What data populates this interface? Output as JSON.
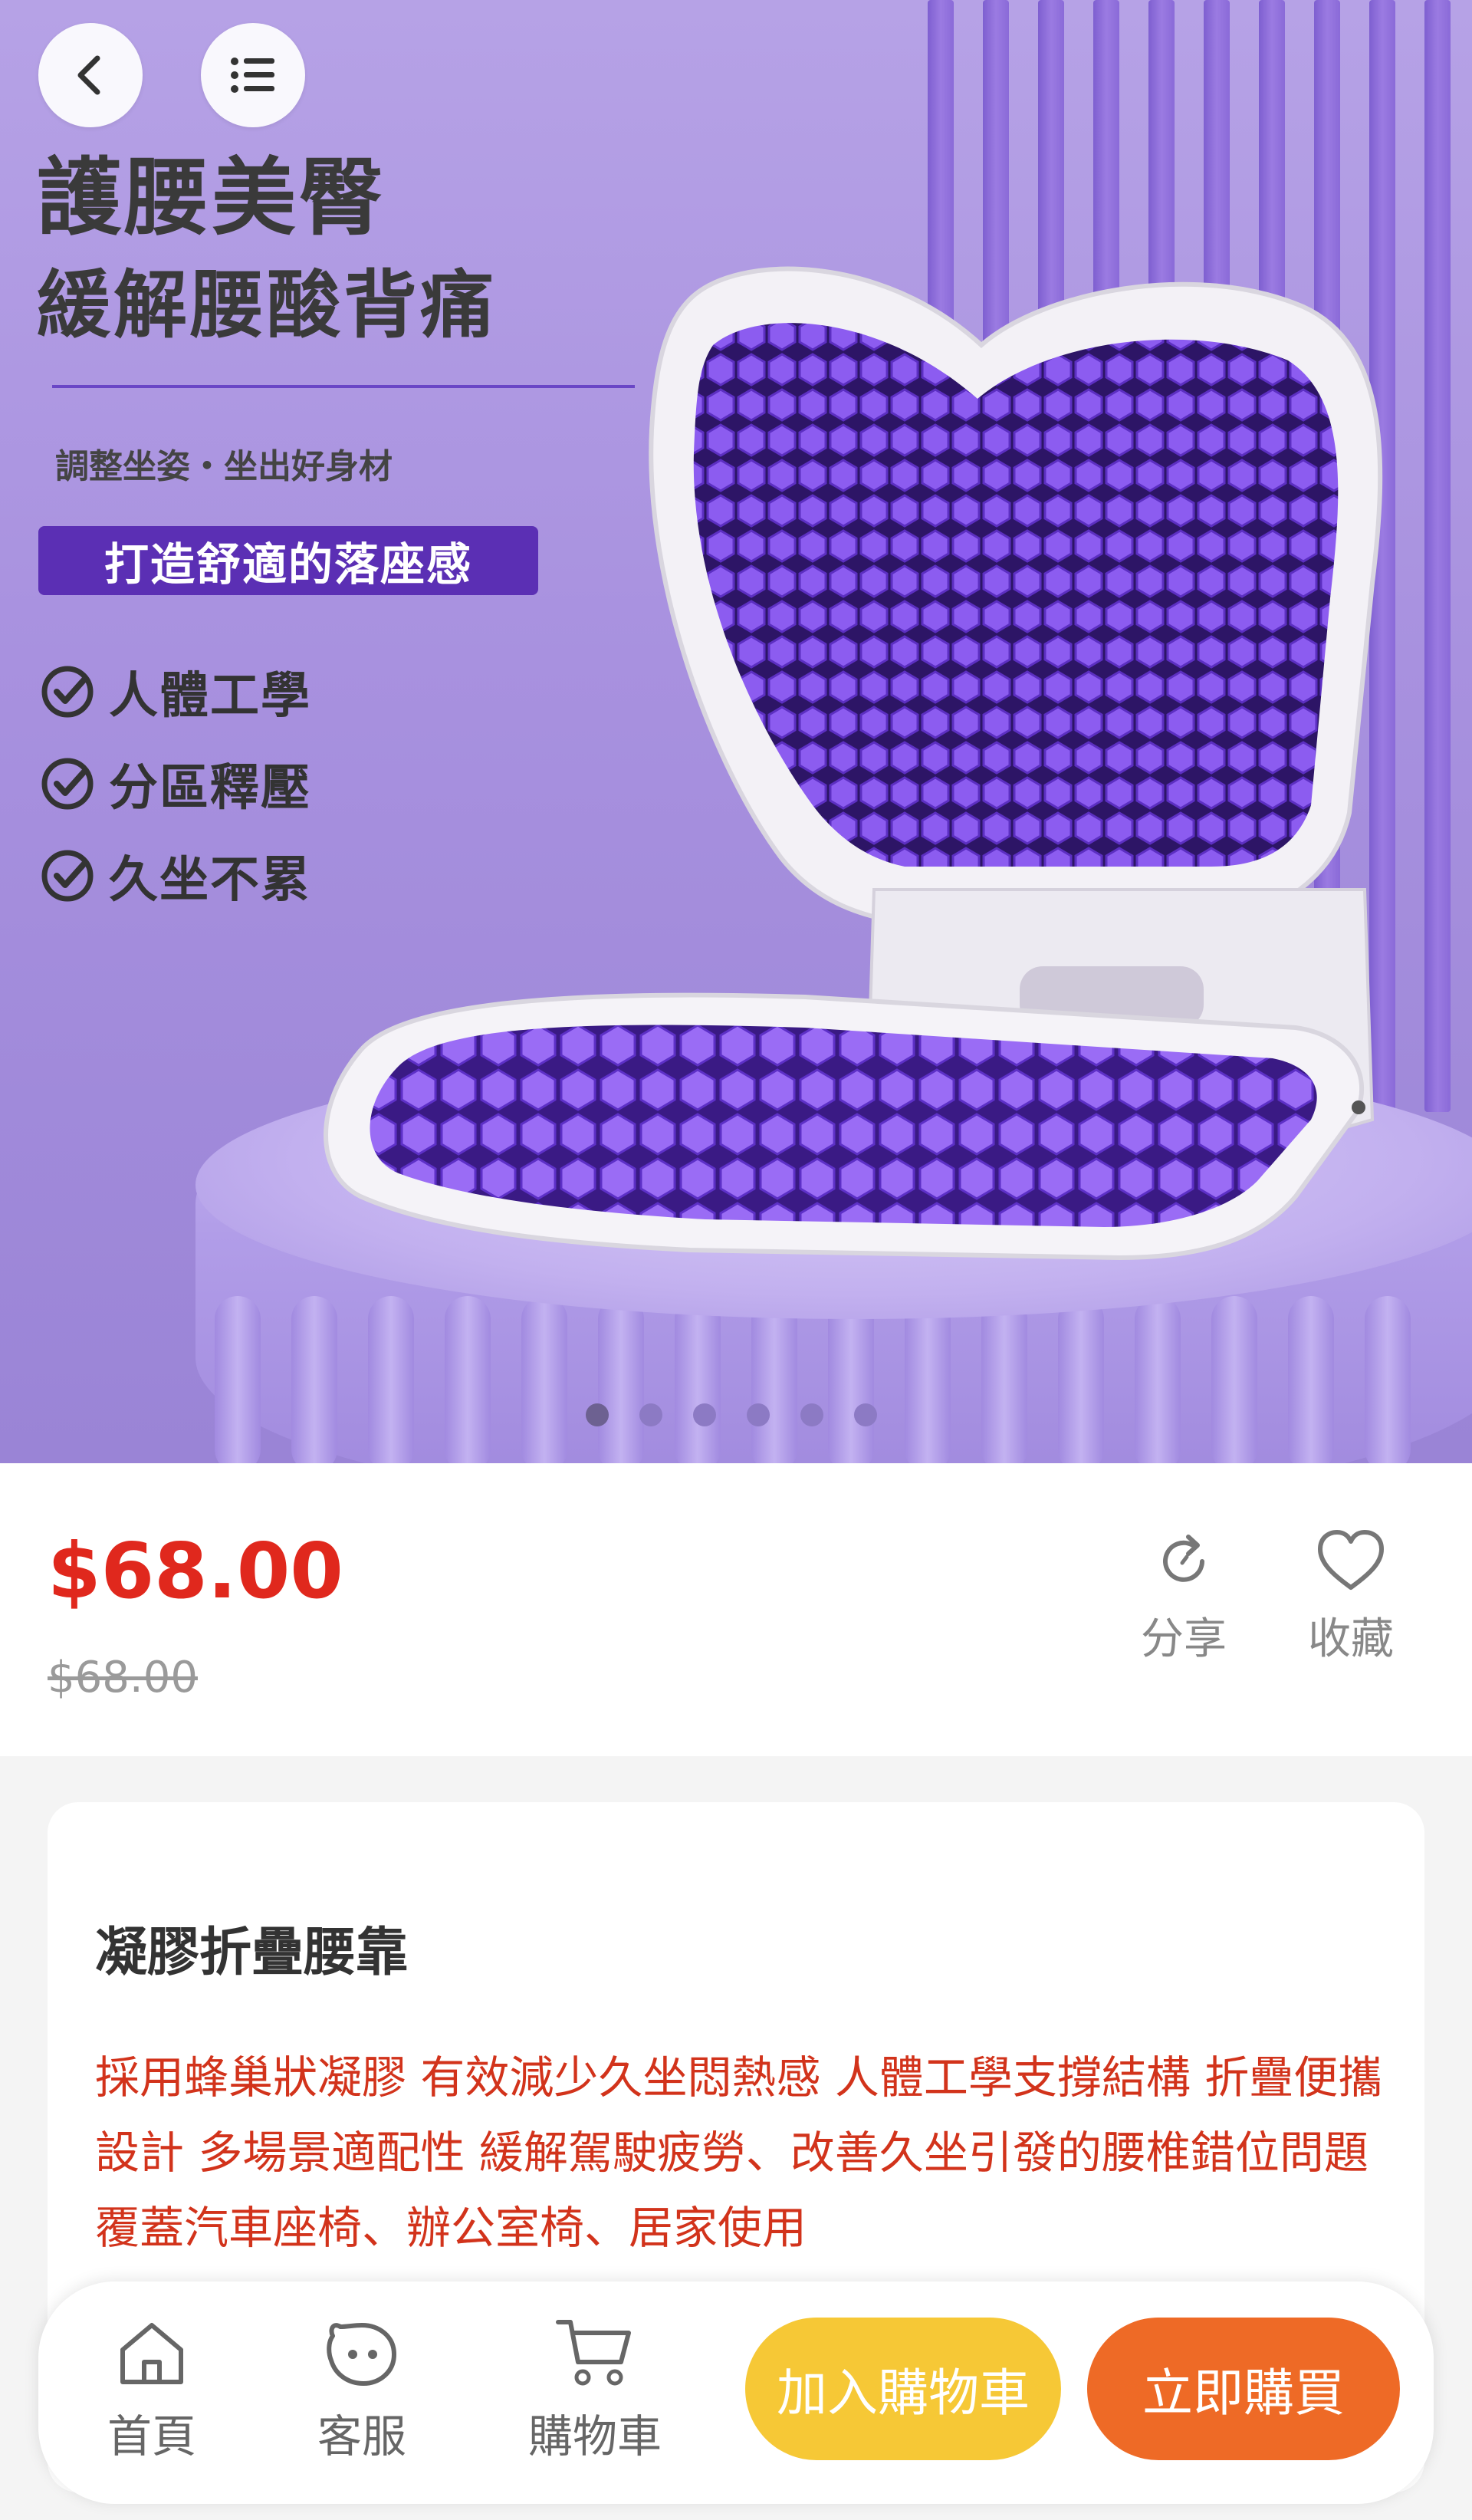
{
  "hero": {
    "title_line1": "護腰美臀",
    "title_line2": "緩解腰酸背痛",
    "subtitle": "調整坐姿・坐出好身材",
    "badge": "打造舒適的落座感",
    "features": [
      "人體工學",
      "分區釋壓",
      "久坐不累"
    ],
    "carousel_count": 6,
    "carousel_active": 1
  },
  "nav": {
    "back_icon": "chevron-left-icon",
    "menu_icon": "list-icon"
  },
  "price": {
    "current": "$68.00",
    "original": "$68.00",
    "share_label": "分享",
    "favorite_label": "收藏"
  },
  "product": {
    "name": "凝膠折疊腰靠",
    "description": "採用蜂巢狀凝膠 有效減少久坐悶熱感 人體工學支撐結構 折疊便攜設計 多場景適配性 緩解駕駛疲勞、改善久坐引發的腰椎錯位問題 覆蓋汽車座椅、辦公室椅、居家使用"
  },
  "bottom_bar": {
    "home_label": "首頁",
    "service_label": "客服",
    "cart_label": "購物車",
    "add_to_cart_label": "加入購物車",
    "buy_now_label": "立即購買"
  },
  "colors": {
    "price_red": "#e0281d",
    "badge_purple": "#5b2fb4",
    "cart_yellow": "#f6c836",
    "buy_orange": "#ee6a26",
    "desc_red": "#d2331b"
  }
}
